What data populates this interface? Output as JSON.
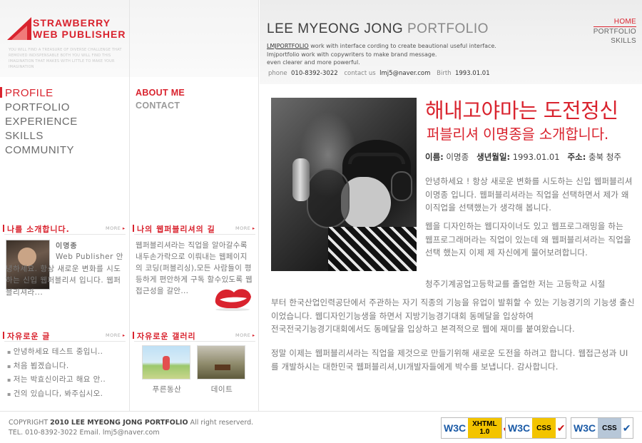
{
  "logo": {
    "line1": "STRAWBERRY",
    "line2": "WEB PUBLISHER",
    "tagline": "YOU WILL FIND A TREASURE OF DIVERSE CHALLENGE THAT REMOVED INDISPENSABLE BOTH YOU WILL FIND THIS IMAGINATION THAT MAKES WITH LITTLE TO MAKE YOUR IMAGINATION"
  },
  "main_nav": [
    "PROFILE",
    "PORTFOLIO",
    "EXPERIENCE",
    "SKILLS",
    "COMMUNITY"
  ],
  "sub_nav": [
    "ABOUT ME",
    "CONTACT"
  ],
  "header": {
    "title_main": "LEE MYEONG JONG",
    "title_accent": " PORTFOLIO",
    "intro_brand": "LMJPORTFOLIO",
    "intro_line1": " work with interface cording to create beautional useful interface.",
    "intro_line2": "lmjportfolio work with copywriters to make brand message.",
    "intro_line3": "even clearer and more powerful.",
    "phone_label": "phone",
    "phone_value": "010-8392-3022",
    "contact_label": "contact us",
    "contact_value": "lmj5@naver.com",
    "birth_label": "Birth",
    "birth_value": "1993.01.01"
  },
  "top_links": [
    "HOME",
    "PORTFOLIO",
    "SKILLS"
  ],
  "about_box": {
    "title": "나를 소개합니다.",
    "more": "MORE",
    "name": "이명종",
    "text": "Web Publisher 안녕하세요. 항상 새로운 변화를 시도하는 신입 웹퍼블리셔 입니다. 웹퍼블리셔라..."
  },
  "road_box": {
    "title": "나의 웹퍼블리셔의 길",
    "more": "MORE",
    "text": "웹퍼블리셔라는 직업을 알아갈수록 내두손가락으로 이뤄내는 웹페이지의 코딩(퍼블리싱),모든 사람들이 평등하게 편안하게 구독 할수있도록 웹접근성을 갈안..."
  },
  "free_box": {
    "title": "자유로운 글",
    "more": "MORE",
    "items": [
      "안녕하세요 테스트 중입니..",
      "처음 뵙겠습니다.",
      "저는 박효신이라고 해요 안..",
      "건의 있습니다, 봐주십시오."
    ]
  },
  "gallery_box": {
    "title": "자유로운 갤러리",
    "more": "MORE",
    "items": [
      "푸른동산",
      "데이트"
    ]
  },
  "content": {
    "headline": "해내고야마는 도전정신",
    "subline": "퍼블리셔 이명종을 소개합니다.",
    "name_label": "이름:",
    "name_value": "이명종",
    "birth_label": "생년월일:",
    "birth_value": "1993.01.01",
    "addr_label": "주소:",
    "addr_value": "충북 청주",
    "p1": "안녕하세요 ! 항상 새로운 변화를 시도하는 신입 웹퍼블리셔 이명종 입니다. 웹퍼블리셔라는 직업을 선택하면서 제가 왜 이직업을 선택했는가 생각해 봅니다.",
    "p2": "웹을 디자인하는 웹디자이너도 있고 웹프로그래밍을 하는 웹프로그래머라는 직업이 있는데 왜 웹퍼블리셔라는 직업을 선택 했는지 이제 제 자신에게 물어보려합니다.",
    "p3a": "청주기계공업고등학교를 졸업한 저는 고등학교 시절",
    "p3b": "부터 한국산업인력공단에서 주관하는 자기 직종의 기능을 유업이 발휘할 수 있는 기능경기의 기능생 출신 이었습니다. 웹디자인기능생을 하면서 지방기능경기대회 동메달을 입상하여 전국전국기능경기대회에서도 동메달을 입상하고 본격적으로 웹에 재미를 붙여왔습니다.",
    "p4": "정말 이제는 웹퍼블리셔라는 직업을 제것으로 만들기위해 새로운 도전을 하려고 합니다. 웹접근성과 UI 를 개발하시는 대한민국 웹퍼블리셔,UI개발자들에게 박수를 보냅니다. 감사합니다."
  },
  "footer": {
    "copy_prefix": "COPYRIGHT ",
    "copy_bold": "2010 LEE MYEONG JONG PORTFOLIO",
    "copy_suffix": " All right reserverd.",
    "contact": "TEL. 010-8392-3022 Email. lmj5@naver.com",
    "badges": [
      {
        "w3": "W3C",
        "kind1": "XHTML",
        "kind2": "1.0"
      },
      {
        "w3": "W3C",
        "kind1": "CSS",
        "kind2": ""
      },
      {
        "w3": "W3C",
        "kind1": "CSS",
        "kind2": ""
      }
    ]
  },
  "colors": {
    "accent": "#d9232e"
  }
}
